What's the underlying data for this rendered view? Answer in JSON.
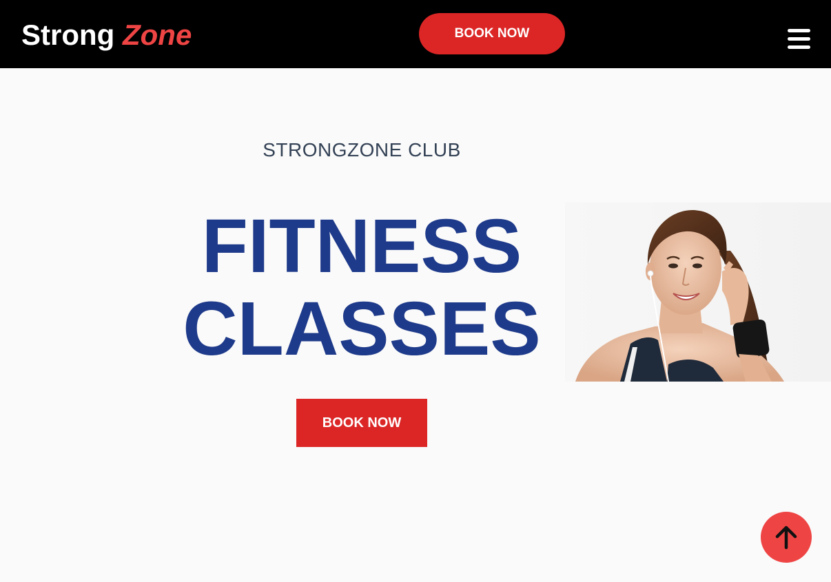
{
  "header": {
    "logo_part1": "Strong",
    "logo_part2": "Zone",
    "book_button": "BOOK NOW",
    "menu_icon": "hamburger-menu-icon"
  },
  "hero": {
    "eyebrow": "STRONGZONE CLUB",
    "headline_line1": "FITNESS",
    "headline_line2": "CLASSES",
    "cta": "BOOK NOW",
    "image_alt": "Smiling woman in sportswear with earphones"
  },
  "scroll_top": {
    "icon": "arrow-up-icon"
  },
  "colors": {
    "nav_bg": "#000000",
    "brand_red": "#dc2626",
    "logo_accent": "#ef4444",
    "headline_blue": "#1e3a8a",
    "page_bg": "#fafafa"
  }
}
